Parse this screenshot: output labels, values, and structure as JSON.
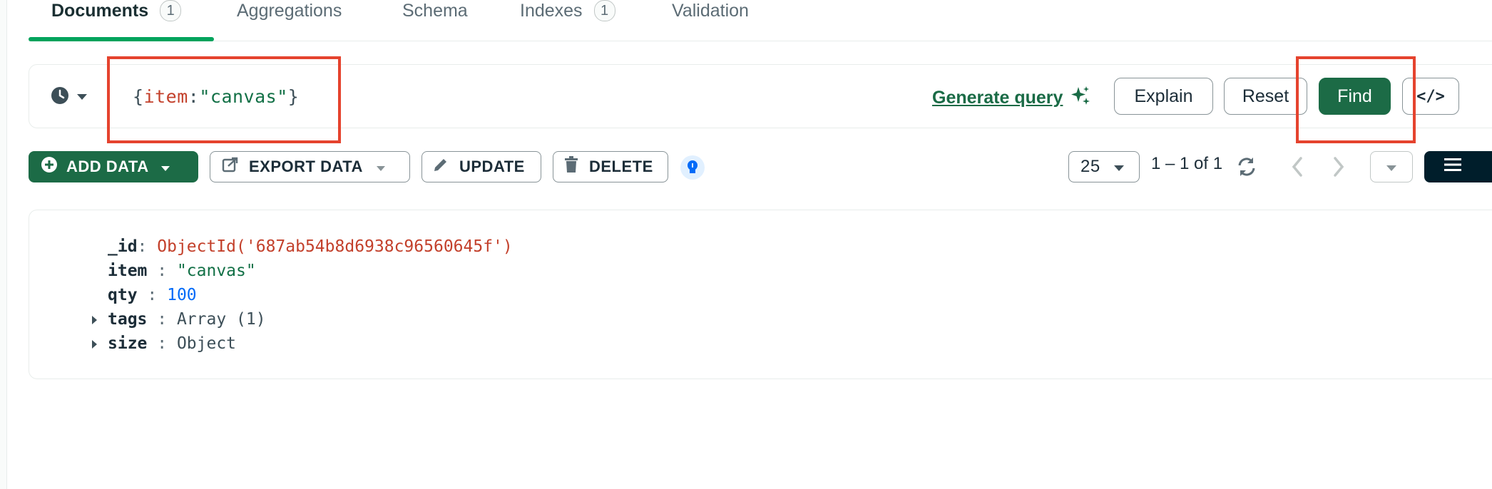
{
  "tabs": [
    {
      "label": "Documents",
      "badge": "1"
    },
    {
      "label": "Aggregations"
    },
    {
      "label": "Schema"
    },
    {
      "label": "Indexes",
      "badge": "1"
    },
    {
      "label": "Validation"
    }
  ],
  "query": {
    "open": "{",
    "key": "item",
    "colon": ": ",
    "value": "\"canvas\"",
    "close": "}",
    "generate_label": "Generate query",
    "explain_label": "Explain",
    "reset_label": "Reset",
    "find_label": "Find",
    "code_icon": "code-icon",
    "history_icon": "clock-icon"
  },
  "toolbar": {
    "add_data": "ADD DATA",
    "export_data": "EXPORT DATA",
    "update": "UPDATE",
    "delete": "DELETE",
    "page_size": "25",
    "range": "1 – 1 of 1"
  },
  "document": {
    "fields": [
      {
        "key": "_id",
        "sep": ": ",
        "value": "ObjectId('687ab54b8d6938c96560645f')",
        "type": "oid",
        "expandable": false
      },
      {
        "key": "item",
        "sep": " : ",
        "value": "\"canvas\"",
        "type": "str",
        "expandable": false
      },
      {
        "key": "qty",
        "sep": " : ",
        "value": "100",
        "type": "num",
        "expandable": false
      },
      {
        "key": "tags",
        "sep": " : ",
        "value": "Array (1)",
        "type": "plain",
        "expandable": true
      },
      {
        "key": "size",
        "sep": " : ",
        "value": "Object",
        "type": "plain",
        "expandable": true
      }
    ]
  },
  "colors": {
    "accent_green": "#00a35c",
    "button_green": "#1c6b46",
    "annotation_red": "#e5432e"
  }
}
